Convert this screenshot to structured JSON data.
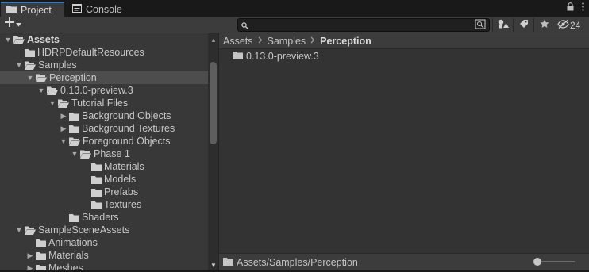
{
  "tabs": [
    {
      "label": "Project",
      "icon": "folder-icon",
      "active": true
    },
    {
      "label": "Console",
      "icon": "console-icon",
      "active": false
    }
  ],
  "toolbar": {
    "add_label": "+",
    "search_placeholder": "",
    "hidden_count": "24"
  },
  "tree": [
    {
      "label": "Assets",
      "depth": 0,
      "expanded": true,
      "bold": true
    },
    {
      "label": "HDRPDefaultResources",
      "depth": 1,
      "leaf": true
    },
    {
      "label": "Samples",
      "depth": 1,
      "expanded": true
    },
    {
      "label": "Perception",
      "depth": 2,
      "expanded": true,
      "selected": true
    },
    {
      "label": "0.13.0-preview.3",
      "depth": 3,
      "expanded": true
    },
    {
      "label": "Tutorial Files",
      "depth": 4,
      "expanded": true
    },
    {
      "label": "Background Objects",
      "depth": 5,
      "collapsed": true
    },
    {
      "label": "Background Textures",
      "depth": 5,
      "collapsed": true
    },
    {
      "label": "Foreground Objects",
      "depth": 5,
      "expanded": true
    },
    {
      "label": "Phase 1",
      "depth": 6,
      "expanded": true
    },
    {
      "label": "Materials",
      "depth": 7,
      "leaf": true
    },
    {
      "label": "Models",
      "depth": 7,
      "leaf": true
    },
    {
      "label": "Prefabs",
      "depth": 7,
      "leaf": true
    },
    {
      "label": "Textures",
      "depth": 7,
      "leaf": true
    },
    {
      "label": "Shaders",
      "depth": 5,
      "leaf": true
    },
    {
      "label": "SampleSceneAssets",
      "depth": 1,
      "expanded": true
    },
    {
      "label": "Animations",
      "depth": 2,
      "leaf": true
    },
    {
      "label": "Materials",
      "depth": 2,
      "collapsed": true
    },
    {
      "label": "Meshes",
      "depth": 2,
      "collapsed": true
    }
  ],
  "breadcrumb": {
    "items": [
      "Assets",
      "Samples"
    ],
    "current": "Perception"
  },
  "content_items": [
    {
      "label": "0.13.0-preview.3"
    }
  ],
  "status": {
    "path": "Assets/Samples/Perception"
  },
  "colors": {
    "accent": "#3a79bb",
    "panel": "#383838",
    "selected_row": "#4d4d4d",
    "content_bg": "#333333"
  }
}
